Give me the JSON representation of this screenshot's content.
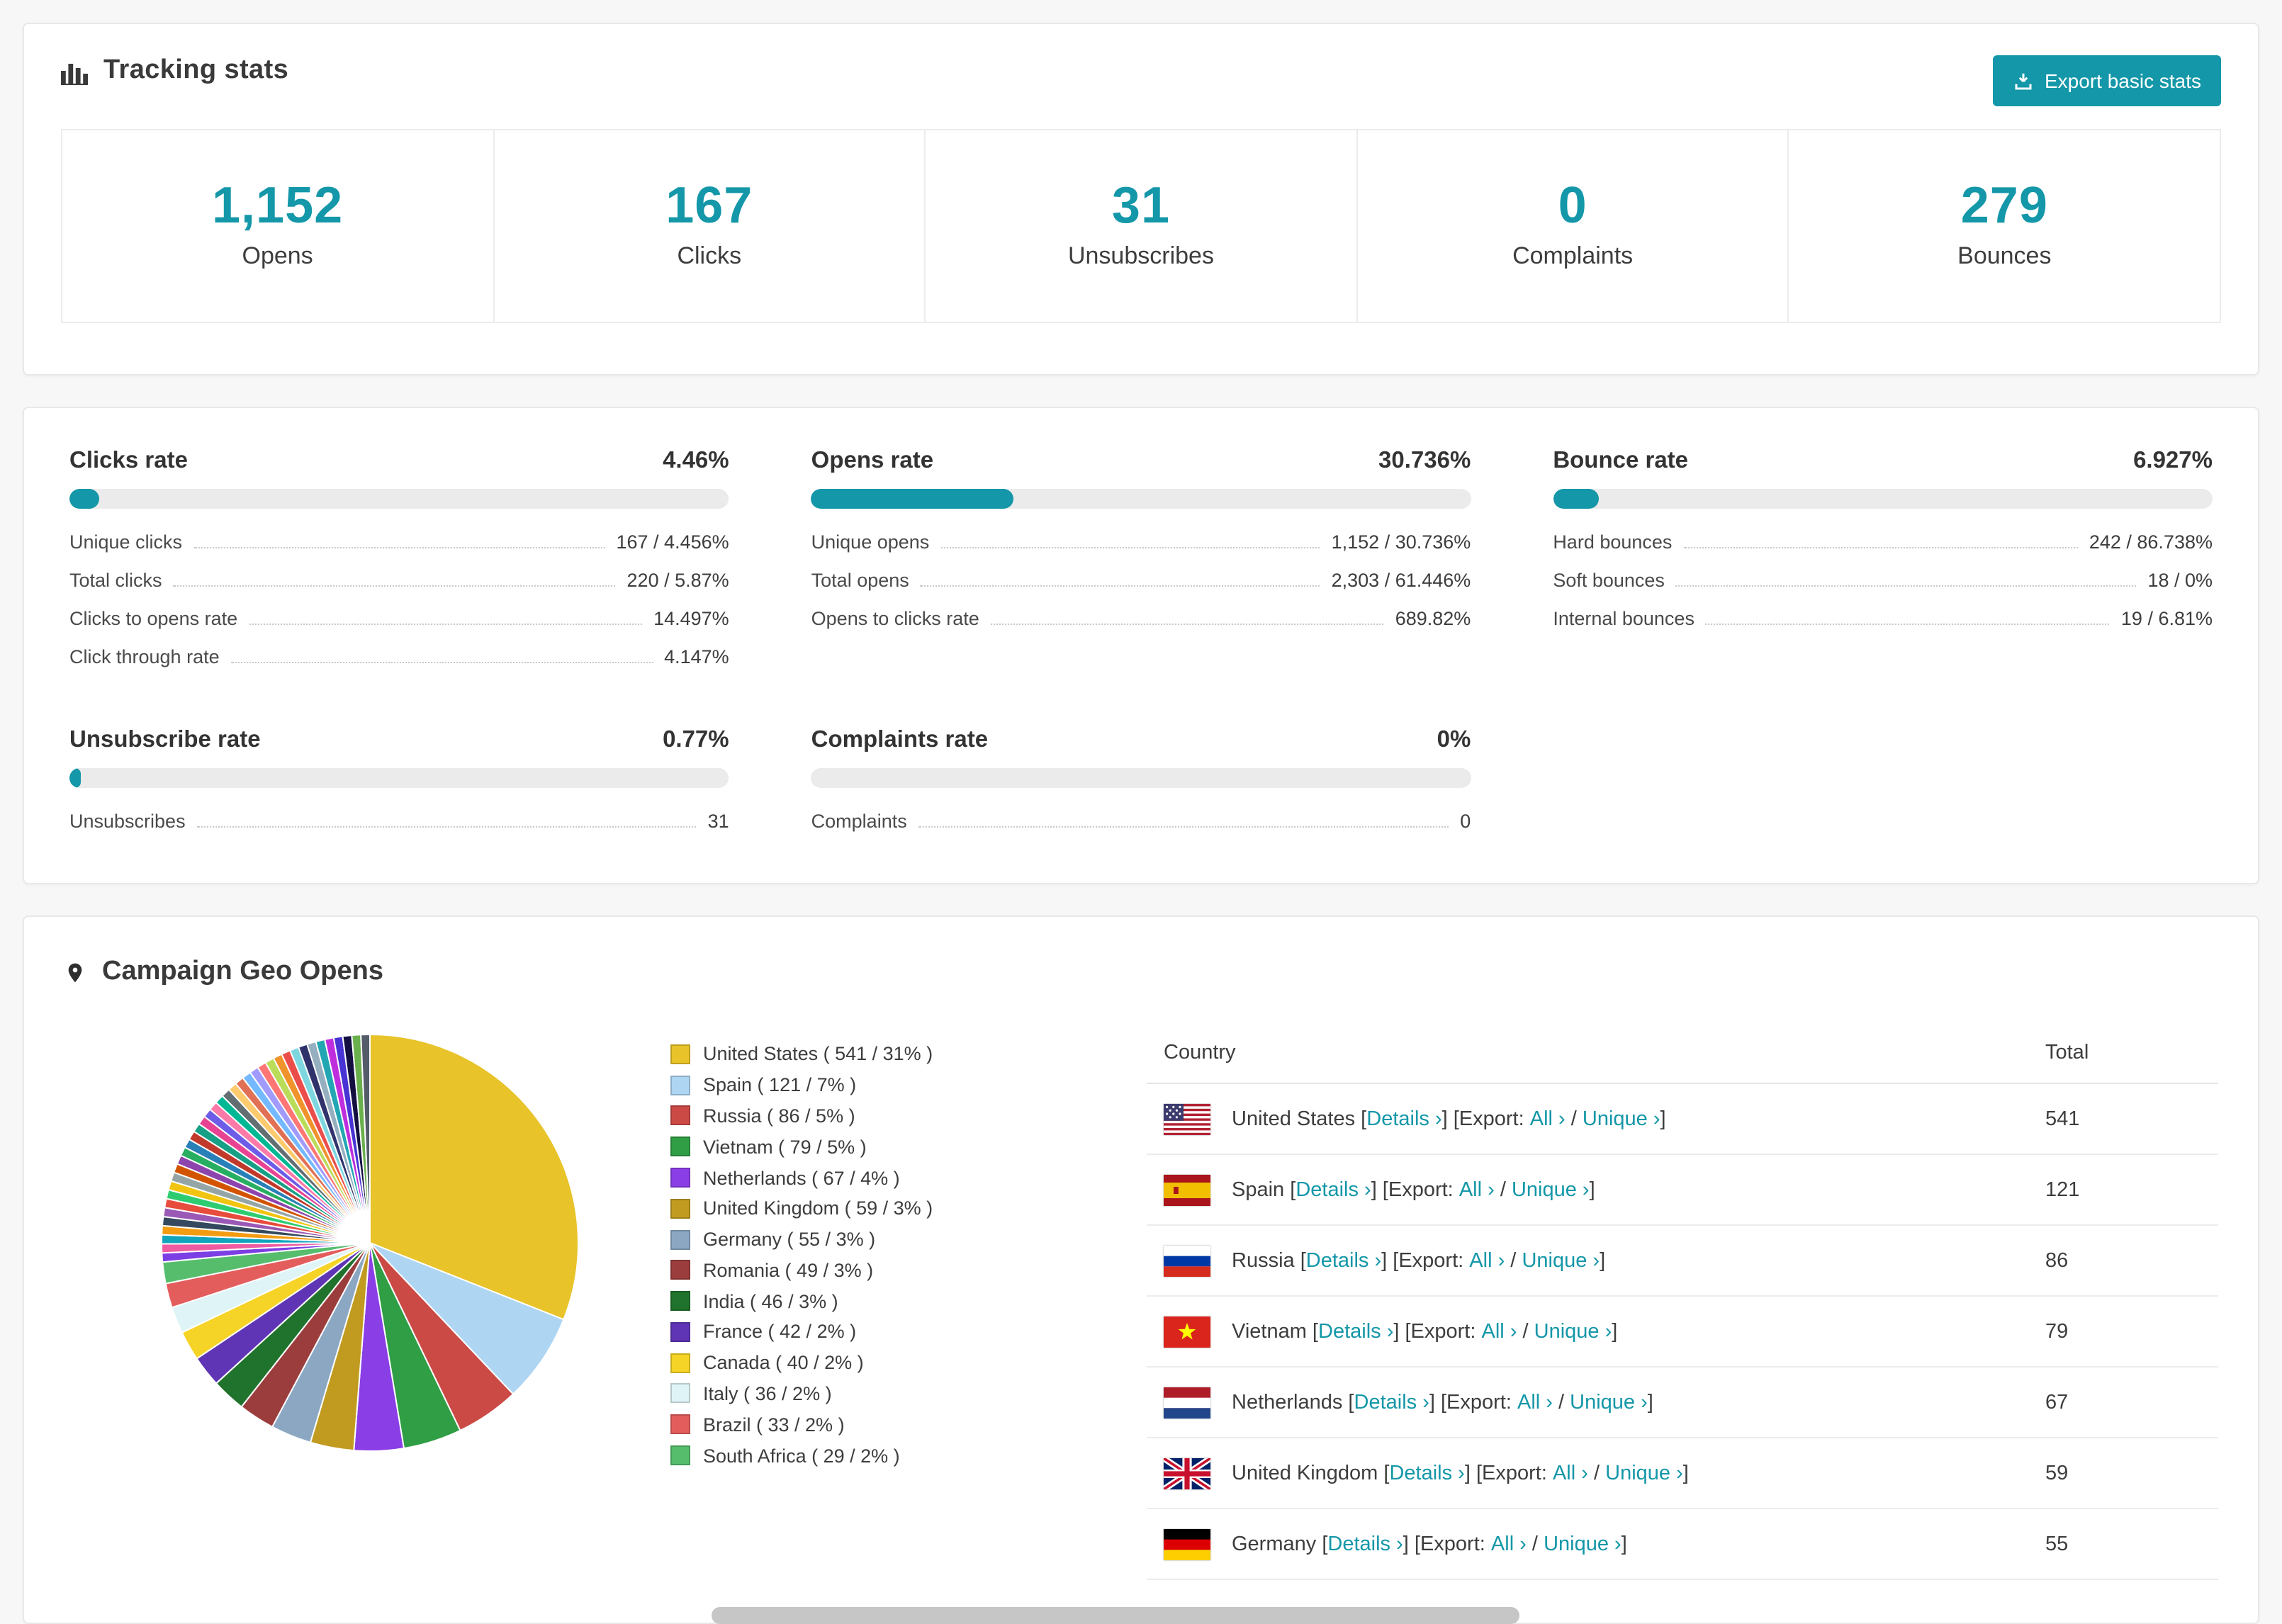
{
  "colors": {
    "accent": "#1497a8",
    "bar_bg": "#ebebeb"
  },
  "tracking_stats": {
    "title": "Tracking stats",
    "export_button": "Export basic stats",
    "stats": [
      {
        "value": "1,152",
        "label": "Opens"
      },
      {
        "value": "167",
        "label": "Clicks"
      },
      {
        "value": "31",
        "label": "Unsubscribes"
      },
      {
        "value": "0",
        "label": "Complaints"
      },
      {
        "value": "279",
        "label": "Bounces"
      }
    ]
  },
  "rates": [
    {
      "title": "Clicks rate",
      "percent": "4.46%",
      "bar": 4.46,
      "rows": [
        {
          "label": "Unique clicks",
          "value": "167 / 4.456%"
        },
        {
          "label": "Total clicks",
          "value": "220 / 5.87%"
        },
        {
          "label": "Clicks to opens rate",
          "value": "14.497%"
        },
        {
          "label": "Click through rate",
          "value": "4.147%"
        }
      ]
    },
    {
      "title": "Opens rate",
      "percent": "30.736%",
      "bar": 30.736,
      "rows": [
        {
          "label": "Unique opens",
          "value": "1,152 / 30.736%"
        },
        {
          "label": "Total opens",
          "value": "2,303 / 61.446%"
        },
        {
          "label": "Opens to clicks rate",
          "value": "689.82%"
        }
      ]
    },
    {
      "title": "Bounce rate",
      "percent": "6.927%",
      "bar": 6.927,
      "rows": [
        {
          "label": "Hard bounces",
          "value": "242 / 86.738%"
        },
        {
          "label": "Soft bounces",
          "value": "18 / 0%"
        },
        {
          "label": "Internal bounces",
          "value": "19 / 6.81%"
        }
      ]
    },
    {
      "title": "Unsubscribe rate",
      "percent": "0.77%",
      "bar": 0.77,
      "rows": [
        {
          "label": "Unsubscribes",
          "value": "31"
        }
      ]
    },
    {
      "title": "Complaints rate",
      "percent": "0%",
      "bar": 0,
      "rows": [
        {
          "label": "Complaints",
          "value": "0"
        }
      ]
    }
  ],
  "geo": {
    "title": "Campaign Geo Opens",
    "table": {
      "country_header": "Country",
      "total_header": "Total",
      "details_link": "Details ›",
      "export_all_link": "All ›",
      "export_unique_link": "Unique ›",
      "sep_open": " [",
      "sep_export": "] [Export: ",
      "sep_slash": " / ",
      "sep_close": "]",
      "rows": [
        {
          "country": "United States",
          "total": "541",
          "flag": "us"
        },
        {
          "country": "Spain",
          "total": "121",
          "flag": "es"
        },
        {
          "country": "Russia",
          "total": "86",
          "flag": "ru"
        },
        {
          "country": "Vietnam",
          "total": "79",
          "flag": "vn"
        },
        {
          "country": "Netherlands",
          "total": "67",
          "flag": "nl"
        },
        {
          "country": "United Kingdom",
          "total": "59",
          "flag": "gb"
        },
        {
          "country": "Germany",
          "total": "55",
          "flag": "de"
        }
      ]
    }
  },
  "chart_data": {
    "type": "pie",
    "title": "Campaign Geo Opens",
    "legend_position": "right",
    "labels": [
      "United States",
      "Spain",
      "Russia",
      "Vietnam",
      "Netherlands",
      "United Kingdom",
      "Germany",
      "Romania",
      "India",
      "France",
      "Canada",
      "Italy",
      "Brazil",
      "South Africa"
    ],
    "values": [
      541,
      121,
      86,
      79,
      67,
      59,
      55,
      49,
      46,
      42,
      40,
      36,
      33,
      29
    ],
    "percents": [
      31,
      7,
      5,
      5,
      4,
      3,
      3,
      3,
      3,
      2,
      2,
      2,
      2,
      2
    ],
    "colors": [
      "#e8c329",
      "#aed5f2",
      "#cb4a46",
      "#2f9e44",
      "#8a3ee6",
      "#c19b20",
      "#8ba7c2",
      "#9c3d3d",
      "#20732c",
      "#5f35b5",
      "#f5d327",
      "#dff4f6",
      "#e35d5d",
      "#55bd6c"
    ],
    "others_value": 462,
    "others_slice_count": 38
  }
}
